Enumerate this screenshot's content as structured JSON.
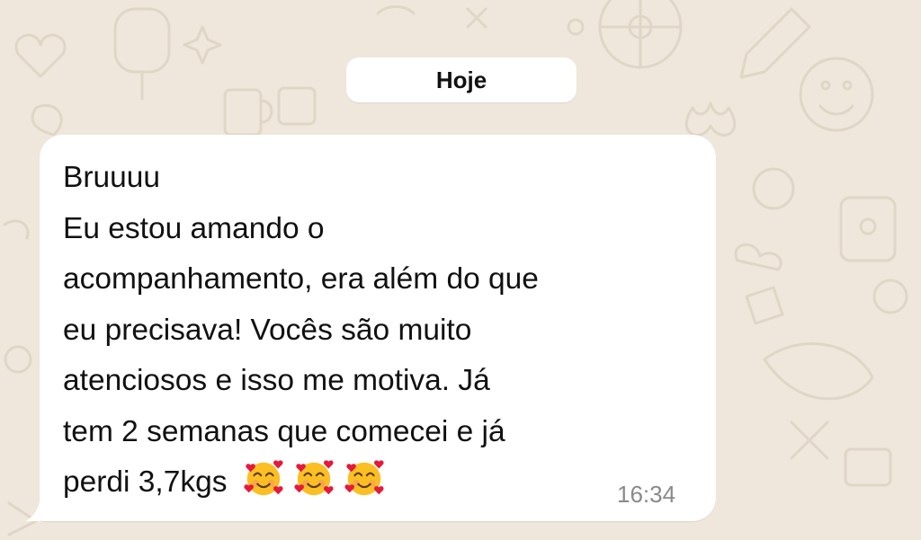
{
  "date_separator": {
    "label": "Hoje"
  },
  "message": {
    "lines": [
      "Bruuuu",
      "Eu estou amando o",
      "acompanhamento, era além do que",
      "eu precisava! Vocês são muito",
      "atenciosos e isso me motiva. Já",
      "tem 2 semanas que comecei e já",
      "perdi 3,7kgs"
    ],
    "emojis": [
      "smiling-face-with-hearts",
      "smiling-face-with-hearts",
      "smiling-face-with-hearts"
    ],
    "time": "16:34"
  },
  "colors": {
    "background": "#efe7dc",
    "bubble": "#ffffff",
    "text": "#111111",
    "time": "#8a8a8a",
    "emoji_face": "#fbbf24",
    "emoji_heart": "#e8173b"
  }
}
